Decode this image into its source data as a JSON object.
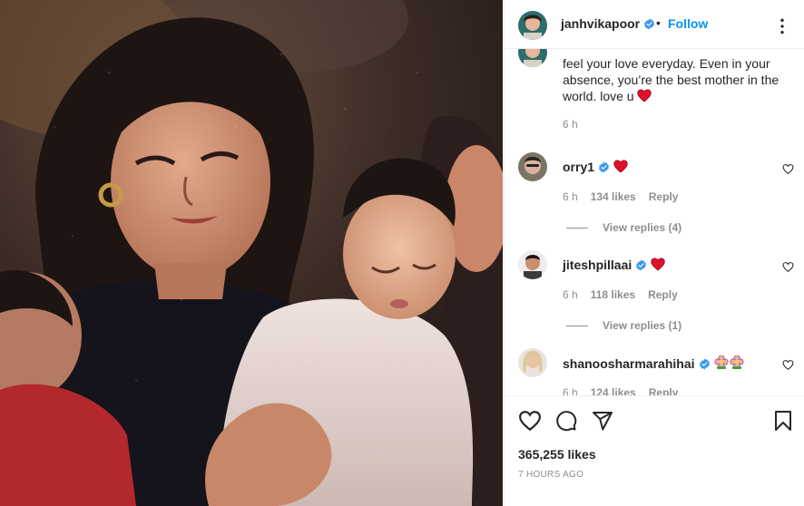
{
  "post": {
    "photo_description_icon": "family-photo",
    "author": {
      "username": "janhvikapoor",
      "verified": true,
      "dot": "•",
      "follow_label": "Follow"
    },
    "caption": {
      "text": "feel your love everyday. Even in your absence, you’re the best mother in the world. love u",
      "emoji": "red-heart",
      "time": "6 h"
    },
    "comments": [
      {
        "username": "orry1",
        "verified": true,
        "emoji": "red-heart",
        "time": "6 h",
        "likes": "134 likes",
        "reply_label": "Reply",
        "view_replies": "View replies (4)"
      },
      {
        "username": "jiteshpillaai",
        "verified": true,
        "emoji": "red-heart",
        "time": "6 h",
        "likes": "118 likes",
        "reply_label": "Reply",
        "view_replies": "View replies (1)"
      },
      {
        "username": "shanoosharmarahihai",
        "verified": true,
        "emoji": "blossom-flowers",
        "time": "6 h",
        "likes": "124 likes",
        "reply_label": "Reply"
      }
    ],
    "like_count": "365,255 likes",
    "posted_ago": "7 HOURS AGO"
  },
  "colors": {
    "accent": "#0095f6",
    "text": "#262626",
    "muted": "#8e8e8e",
    "heart": "#ed4956",
    "verified": "#3897f0"
  }
}
